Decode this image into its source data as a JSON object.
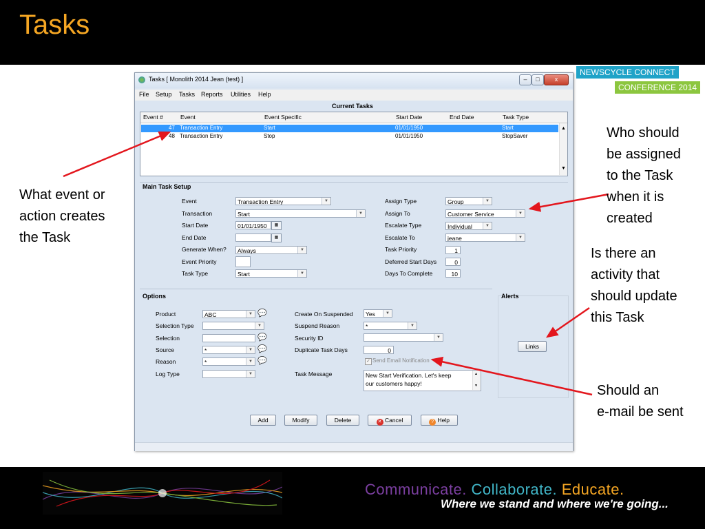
{
  "slide": {
    "title": "Tasks",
    "badge_line1": "NEWSCYCLE CONNECT",
    "badge_line2": "CONFERENCE 2014",
    "tagline": {
      "word1": "Communicate.",
      "word2": "Collaborate.",
      "word3": "Educate.",
      "sub": "Where we stand and where we're going..."
    },
    "colors": {
      "title": "#f5a623",
      "word1": "#7b3fa0",
      "word2": "#41b6c8",
      "word3": "#f5a623",
      "arrow": "#e3161d",
      "badge1": "#1fa3c8",
      "badge2": "#8cc63f"
    }
  },
  "callouts": {
    "left_l1": "What event or",
    "left_l2": "action creates",
    "left_l3": "the Task",
    "assign_l1": "Who should",
    "assign_l2": "be assigned",
    "assign_l3": "to the Task",
    "assign_l4": "when it is",
    "assign_l5": "created",
    "activity_l1": "Is there an",
    "activity_l2": "activity that",
    "activity_l3": "should update",
    "activity_l4": "this Task",
    "email_l1": "Should an",
    "email_l2": "e-mail be sent"
  },
  "window": {
    "title": "Tasks [ Monolith 2014 Jean (test) ]",
    "menu": [
      "File",
      "Setup",
      "Tasks",
      "Reports",
      "Utilities",
      "Help"
    ],
    "current_tasks": {
      "heading": "Current Tasks",
      "columns": [
        "Event #",
        "Event",
        "Event Specific",
        "Start Date",
        "End Date",
        "Task Type"
      ],
      "rows": [
        [
          "47",
          "Transaction Entry",
          "Start",
          "01/01/1950",
          "",
          "Start"
        ],
        [
          "48",
          "Transaction Entry",
          "Stop",
          "01/01/1950",
          "",
          "StopSaver"
        ]
      ]
    },
    "main_setup": {
      "heading": "Main Task Setup",
      "event_label": "Event",
      "event_value": "Transaction Entry",
      "transaction_label": "Transaction",
      "transaction_value": "Start",
      "start_date_label": "Start Date",
      "start_date_value": "01/01/1950",
      "end_date_label": "End Date",
      "end_date_value": "",
      "generate_label": "Generate When?",
      "generate_value": "Always",
      "priority_label": "Event Priority",
      "priority_value": "",
      "task_type_label": "Task Type",
      "task_type_value": "Start",
      "assign_type_label": "Assign Type",
      "assign_type_value": "Group",
      "assign_to_label": "Assign To",
      "assign_to_value": "Customer Service",
      "escalate_type_label": "Escalate Type",
      "escalate_type_value": "Individual",
      "escalate_to_label": "Escalate To",
      "escalate_to_value": "jeane",
      "task_priority_label": "Task Priority",
      "task_priority_value": "1",
      "deferred_label": "Deferred Start Days",
      "deferred_value": "0",
      "days_label": "Days To Complete",
      "days_value": "10"
    },
    "options": {
      "heading": "Options",
      "product_label": "Product",
      "product_value": "ABC",
      "selection_type_label": "Selection Type",
      "selection_type_value": "",
      "selection_label": "Selection",
      "selection_value": "",
      "source_label": "Source",
      "source_value": "*",
      "reason_label": "Reason",
      "reason_value": "*",
      "log_type_label": "Log Type",
      "log_type_value": "",
      "create_susp_label": "Create On Suspended",
      "create_susp_value": "Yes",
      "susp_reason_label": "Suspend Reason",
      "susp_reason_value": "*",
      "security_label": "Security ID",
      "security_value": "",
      "dup_label": "Duplicate Task Days",
      "dup_value": "0",
      "email_label": "Send Email Notification",
      "message_label": "Task Message",
      "message_line1": "New Start Verification.  Let's keep",
      "message_line2": "our customers happy!"
    },
    "alerts": {
      "heading": "Alerts",
      "links_button": "Links"
    },
    "buttons": {
      "add": "Add",
      "modify": "Modify",
      "delete": "Delete",
      "cancel": "Cancel",
      "help": "Help"
    }
  }
}
